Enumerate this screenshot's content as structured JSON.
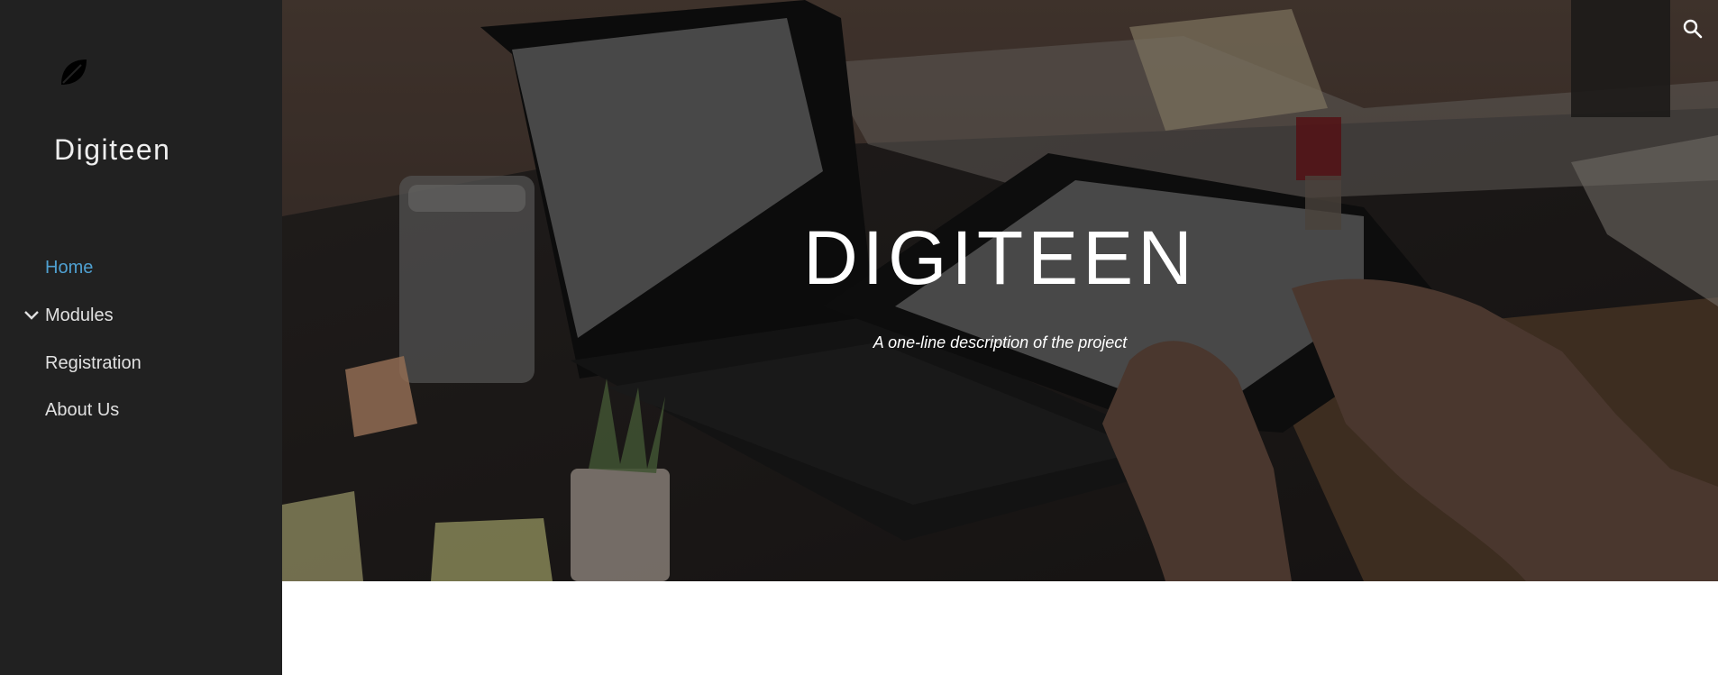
{
  "sidebar": {
    "logo_icon": "leaf-icon",
    "site_title": "Digiteen",
    "nav": [
      {
        "label": "Home",
        "active": true
      },
      {
        "label": "Modules",
        "expandable": true,
        "icon": "chevron-down-icon"
      },
      {
        "label": "Registration"
      },
      {
        "label": "About Us"
      }
    ]
  },
  "hero": {
    "title": "DIGITEEN",
    "subtitle": "A one-line description of the project"
  },
  "header": {
    "search_icon": "search-icon"
  },
  "colors": {
    "sidebar_bg": "#212121",
    "active_link": "#4fa0d1",
    "nav_text": "#e0e0e0"
  }
}
